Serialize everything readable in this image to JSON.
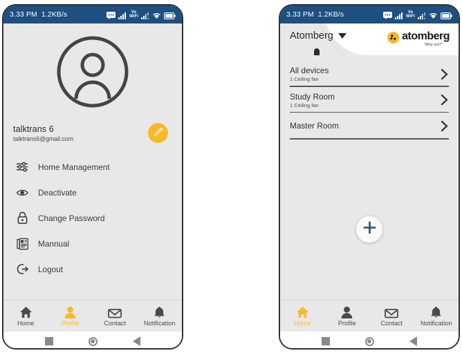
{
  "statusbar": {
    "time": "3.33 PM",
    "network_speed": "1.2KB/s",
    "icons": [
      "message-icon",
      "signal-bars-icon",
      "vowifi-icon",
      "signal-off-icon",
      "wifi-icon",
      "battery-icon"
    ],
    "vowifi_top": "Vo",
    "vowifi_bottom": "WiFi",
    "background": "#1d4f80",
    "text_color": "#ffffff"
  },
  "left_screen": {
    "avatar_icon": "person-placeholder-icon",
    "profile": {
      "name": "talktrans 6",
      "email": "talktrans6@gmail.com",
      "edit_icon": "pencil-icon",
      "edit_color": "#fcb827"
    },
    "menu": [
      {
        "label": "Home Management",
        "icon": "sliders-icon"
      },
      {
        "label": "Deactivate",
        "icon": "eye-icon"
      },
      {
        "label": "Change Password",
        "icon": "lock-icon"
      },
      {
        "label": "Mannual",
        "icon": "manual-book-icon"
      },
      {
        "label": "Logout",
        "icon": "logout-icon"
      }
    ],
    "bottom_nav": [
      {
        "label": "Home",
        "icon": "home-icon",
        "active": false
      },
      {
        "label": "Profile",
        "icon": "person-icon",
        "active": true
      },
      {
        "label": "Contact",
        "icon": "envelope-icon",
        "active": false
      },
      {
        "label": "Notification",
        "icon": "bell-icon",
        "active": false
      }
    ]
  },
  "right_screen": {
    "header": {
      "home_selector": "Atomberg",
      "caret_icon": "chevron-down-icon",
      "brand_name": "atomberg",
      "brand_tagline": "\"Why not?\"",
      "brand_mark_icon": "atomberg-fan-icon",
      "brand_mark_color": "#fcb827",
      "cursor_icon": "pointing-hand-cursor"
    },
    "devices": [
      {
        "name": "All devices",
        "subtitle": "1 Ceiling fan",
        "chevron": "chevron-right-icon"
      },
      {
        "name": "Study Room",
        "subtitle": "1 Ceiling fan",
        "chevron": "chevron-right-icon"
      },
      {
        "name": "Master Room",
        "subtitle": "",
        "chevron": "chevron-right-icon"
      }
    ],
    "add_button": {
      "icon": "plus-icon",
      "color": "#1d4f80"
    },
    "bottom_nav": [
      {
        "label": "Home",
        "icon": "home-icon",
        "active": true
      },
      {
        "label": "Profile",
        "icon": "person-icon",
        "active": false
      },
      {
        "label": "Contact",
        "icon": "envelope-icon",
        "active": false
      },
      {
        "label": "Notification",
        "icon": "bell-icon",
        "active": false
      }
    ]
  },
  "system_nav": {
    "recents": "square-recents-button",
    "home": "circle-home-button",
    "back": "triangle-back-button"
  }
}
